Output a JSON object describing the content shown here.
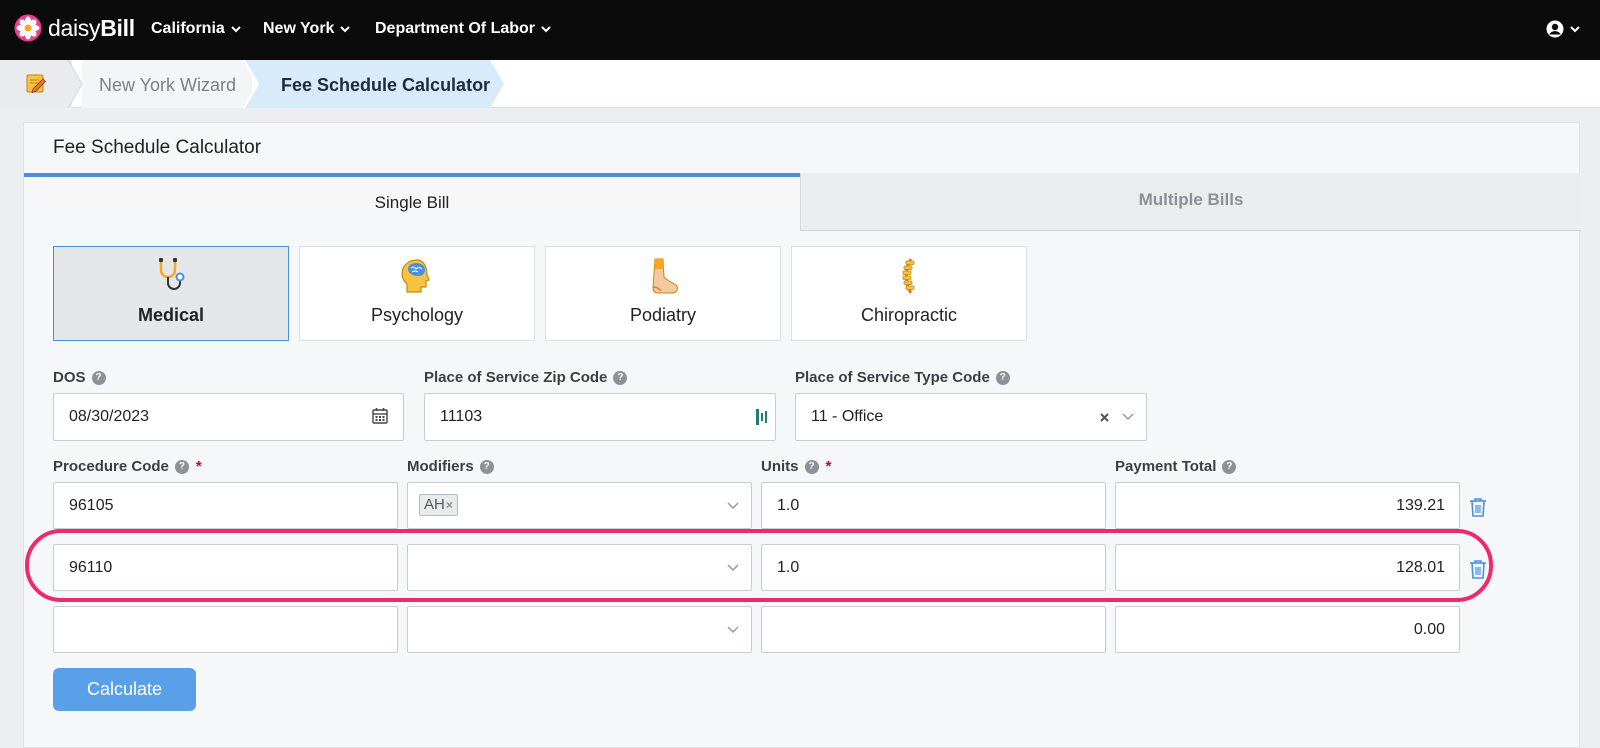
{
  "app": {
    "brand_light": "daisy",
    "brand_bold": "Bill",
    "brand_color": "#e83e8c"
  },
  "nav": {
    "items": [
      {
        "label": "California"
      },
      {
        "label": "New York"
      },
      {
        "label": "Department Of Labor"
      }
    ],
    "user_icon": "user-circle-icon"
  },
  "breadcrumb": {
    "home_icon": "notepad-pencil-icon",
    "items": [
      {
        "label": "New York Wizard"
      },
      {
        "label": "Fee Schedule Calculator"
      }
    ]
  },
  "panel": {
    "title": "Fee Schedule Calculator",
    "tabs": [
      {
        "label": "Single Bill",
        "active": true
      },
      {
        "label": "Multiple Bills",
        "active": false
      }
    ]
  },
  "specialties": [
    {
      "label": "Medical",
      "icon": "stethoscope-icon",
      "active": true
    },
    {
      "label": "Psychology",
      "icon": "brain-head-icon",
      "active": false
    },
    {
      "label": "Podiatry",
      "icon": "foot-icon",
      "active": false
    },
    {
      "label": "Chiropractic",
      "icon": "spine-icon",
      "active": false
    }
  ],
  "form": {
    "dos": {
      "label": "DOS",
      "value": "08/30/2023"
    },
    "zip": {
      "label": "Place of Service Zip Code",
      "value": "11103"
    },
    "pos_type": {
      "label": "Place of Service Type Code",
      "value": "11 - Office"
    },
    "columns": {
      "procedure": "Procedure Code",
      "modifiers": "Modifiers",
      "units": "Units",
      "payment": "Payment Total",
      "required_mark": "*"
    },
    "rows": [
      {
        "procedure": "96105",
        "modifier": "AH",
        "units": "1.0",
        "payment": "139.21"
      },
      {
        "procedure": "96110",
        "modifier": "",
        "units": "1.0",
        "payment": "128.01"
      },
      {
        "procedure": "",
        "modifier": "",
        "units": "",
        "payment": "0.00"
      }
    ],
    "calculate_label": "Calculate",
    "help_glyph": "?"
  },
  "colors": {
    "accent": "#4a90e2",
    "highlight": "#ee2a6e",
    "button": "#5aa0e8"
  }
}
